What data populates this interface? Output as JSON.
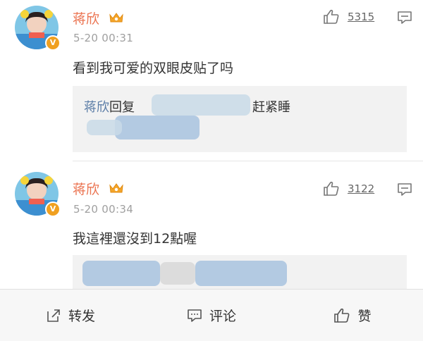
{
  "comments": [
    {
      "user": "蒋欣",
      "time": "5-20 00:31",
      "text": "看到我可爱的双眼皮贴了吗",
      "likes": "5315",
      "reply": {
        "name": "蒋欣",
        "label": "回复",
        "visible_tail": "赶紧睡"
      }
    },
    {
      "user": "蒋欣",
      "time": "5-20 00:34",
      "text": "我這裡還沒到12點喔",
      "likes": "3122"
    }
  ],
  "bottom_bar": {
    "repost_label": "转发",
    "comment_label": "评论",
    "like_label": "赞"
  },
  "colors": {
    "username": "#eb7350",
    "reply_name": "#5a7ca6",
    "timestamp": "#a0a0a0"
  },
  "icons": [
    "verified-badge-icon",
    "crown-badge-icon",
    "thumbs-up-icon",
    "comment-icon",
    "repost-icon"
  ]
}
